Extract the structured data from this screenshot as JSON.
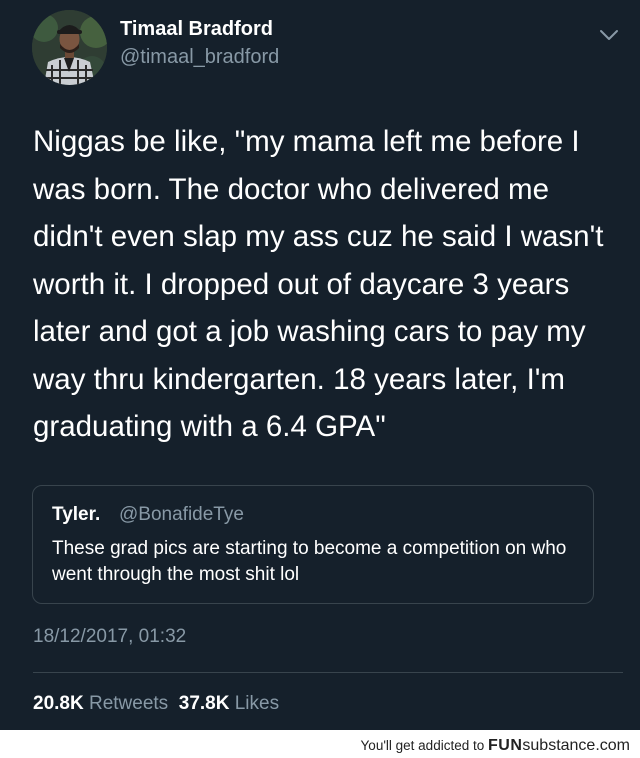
{
  "tweet": {
    "author_name": "Timaal Bradford",
    "author_handle": "@timaal_bradford",
    "avatar_icon": "profile-photo",
    "menu_icon": "chevron-down-icon",
    "text": "Niggas be like, \"my mama left me before I\nwas born. The doctor who delivered me\ndidn't even slap my ass cuz he said I wasn't\nworth it. I dropped out of daycare 3 years\nlater and got a job washing cars to pay my\nway thru kindergarten. 18 years later, I'm\ngraduating with a 6.4 GPA\"",
    "quoted": {
      "name": "Tyler.",
      "handle": "@BonafideTye",
      "text": "These grad pics are starting to become a competition on who went through the most shit lol"
    },
    "timestamp": "18/12/2017, 01:32",
    "retweets_count": "20.8K",
    "retweets_label": "Retweets",
    "likes_count": "37.8K",
    "likes_label": "Likes"
  },
  "footer": {
    "text_prefix": "You'll get addicted to",
    "brand_bold": "FUN",
    "brand_rest": "substance",
    "brand_suffix": ".com"
  },
  "colors": {
    "background": "#15202b",
    "secondary_text": "#8899a6",
    "border": "#38444d"
  }
}
